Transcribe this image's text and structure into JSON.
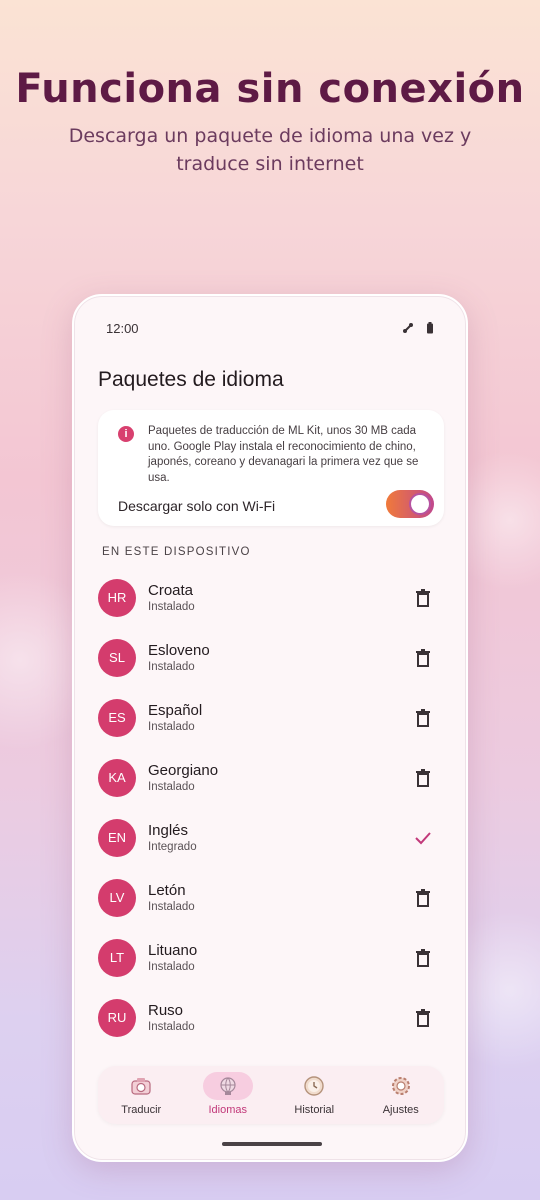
{
  "promo": {
    "headline": "Funciona sin conexión",
    "subline": "Descarga un paquete de idioma una vez y traduce sin internet"
  },
  "status_bar": {
    "time": "12:00",
    "icons": [
      "signal-icon",
      "battery-icon"
    ]
  },
  "page": {
    "title": "Paquetes de idioma"
  },
  "info_card": {
    "icon": "info-icon",
    "text": "Paquetes de traducción de ML Kit, unos 30 MB cada uno. Google Play instala el reconocimiento de chino, japonés, coreano y devanagari la primera vez que se usa.",
    "wifi_label": "Descargar solo con Wi-Fi",
    "wifi_toggle_on": true
  },
  "section": {
    "label": "EN ESTE DISPOSITIVO"
  },
  "languages": [
    {
      "code": "HR",
      "name": "Croata",
      "status": "Instalado",
      "action": "trash-icon"
    },
    {
      "code": "SL",
      "name": "Esloveno",
      "status": "Instalado",
      "action": "trash-icon"
    },
    {
      "code": "ES",
      "name": "Español",
      "status": "Instalado",
      "action": "trash-icon"
    },
    {
      "code": "KA",
      "name": "Georgiano",
      "status": "Instalado",
      "action": "trash-icon"
    },
    {
      "code": "EN",
      "name": "Inglés",
      "status": "Integrado",
      "action": "check-icon"
    },
    {
      "code": "LV",
      "name": "Letón",
      "status": "Instalado",
      "action": "trash-icon"
    },
    {
      "code": "LT",
      "name": "Lituano",
      "status": "Instalado",
      "action": "trash-icon"
    },
    {
      "code": "RU",
      "name": "Ruso",
      "status": "Instalado",
      "action": "trash-icon"
    }
  ],
  "nav": {
    "items": [
      {
        "label": "Traducir",
        "icon": "camera-icon",
        "active": false
      },
      {
        "label": "Idiomas",
        "icon": "globe-icon",
        "active": true
      },
      {
        "label": "Historial",
        "icon": "clock-icon",
        "active": false
      },
      {
        "label": "Ajustes",
        "icon": "gear-icon",
        "active": false
      }
    ]
  },
  "colors": {
    "headline": "#5e1a45",
    "accent": "#d43c6d",
    "nav_active": "#c2397a"
  }
}
